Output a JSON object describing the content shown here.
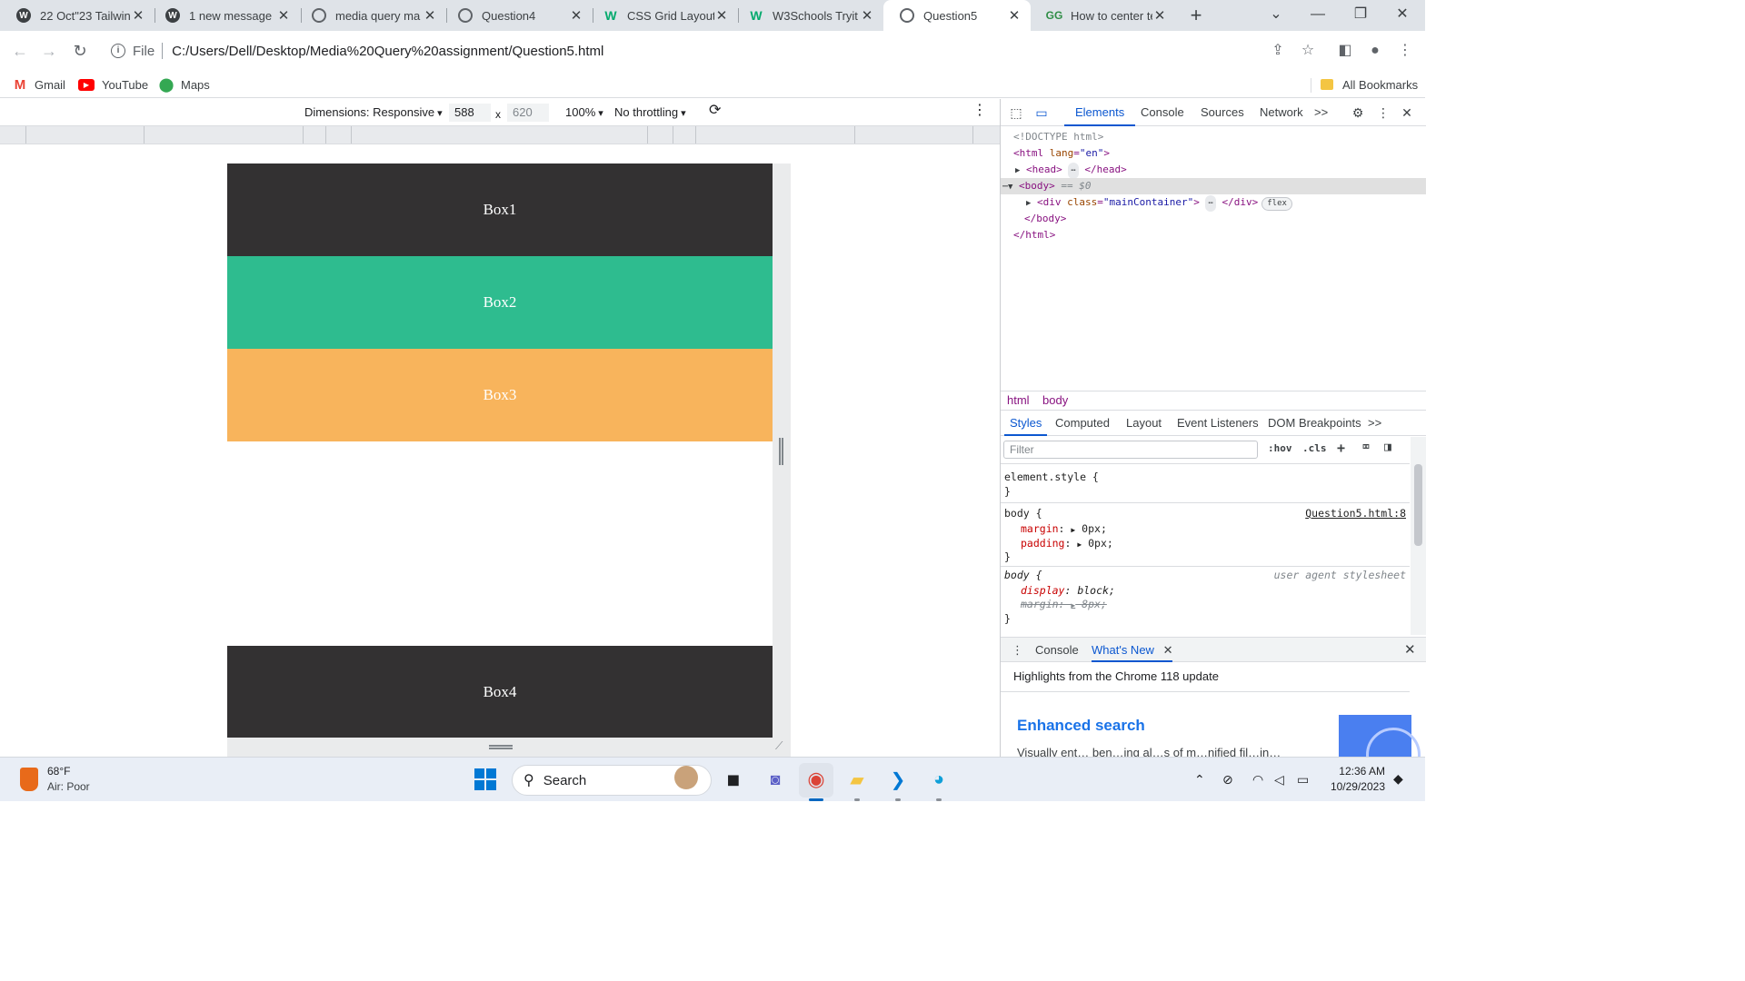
{
  "browser": {
    "tabs": [
      {
        "title": "22 Oct\"23 Tailwin",
        "favicon": "wordpress-icon",
        "active": false
      },
      {
        "title": "1 new message",
        "favicon": "wordpress-icon",
        "active": false
      },
      {
        "title": "media query ma",
        "favicon": "globe-icon",
        "active": false
      },
      {
        "title": "Question4",
        "favicon": "globe-icon",
        "active": false
      },
      {
        "title": "CSS Grid Layout",
        "favicon": "w3schools-icon",
        "active": false
      },
      {
        "title": "W3Schools Tryit",
        "favicon": "w3schools-icon",
        "active": false
      },
      {
        "title": "Question5",
        "favicon": "globe-icon",
        "active": true
      },
      {
        "title": "How to center te",
        "favicon": "geeksforgeeks-icon",
        "active": false
      }
    ],
    "new_tab": "+",
    "window_controls": {
      "tab_search": "⌄",
      "minimize": "—",
      "maximize": "❐",
      "close": "✕"
    },
    "address": {
      "scheme_label": "File",
      "url": "C:/Users/Dell/Desktop/Media%20Query%20assignment/Question5.html"
    },
    "bookmarks": [
      {
        "label": "Gmail"
      },
      {
        "label": "YouTube"
      },
      {
        "label": "Maps"
      }
    ],
    "all_bookmarks": "All Bookmarks"
  },
  "device_toolbar": {
    "dimensions": "Dimensions: Responsive",
    "width": "588",
    "times": "x",
    "height": "620",
    "zoom": "100%",
    "throttling": "No throttling"
  },
  "page": {
    "boxes": [
      {
        "label": "Box1",
        "color": "#333132"
      },
      {
        "label": "Box2",
        "color": "#2ebc8f"
      },
      {
        "label": "Box3",
        "color": "#f8b45c"
      },
      {
        "label": "Box4",
        "color": "#333132"
      }
    ]
  },
  "devtools": {
    "tabs": [
      "Elements",
      "Console",
      "Sources",
      "Network"
    ],
    "more_tabs": ">>",
    "elements": {
      "doctype": "<!DOCTYPE html>",
      "html_open_tag": "html",
      "html_attr_name": "lang",
      "html_attr_value": "\"en\"",
      "head_tag": "head",
      "body_tag": "body",
      "body_marker": "== $0",
      "div_tag": "div",
      "div_attr_name": "class",
      "div_attr_value": "\"mainContainer\"",
      "ellipsis": "⋯",
      "flex_badge": "flex"
    },
    "breadcrumbs": [
      "html",
      "body"
    ],
    "styles_tabs": [
      "Styles",
      "Computed",
      "Layout",
      "Event Listeners",
      "DOM Breakpoints"
    ],
    "filter_placeholder": "Filter",
    "filter_tools": {
      "hov": ":hov",
      "cls": ".cls"
    },
    "rules": {
      "element_style": "element.style {",
      "body_rule_selector": "body {",
      "body_rule_source": "Question5.html:8",
      "body_rule_props": [
        {
          "name": "margin",
          "value": "0px;"
        },
        {
          "name": "padding",
          "value": "0px;"
        }
      ],
      "ua_rule_selector": "body {",
      "ua_rule_source": "user agent stylesheet",
      "ua_rule_props": [
        {
          "name": "display",
          "value": "block;"
        },
        {
          "name": "margin",
          "value": "8px;"
        }
      ],
      "close_brace": "}"
    },
    "drawer": {
      "tabs": [
        "Console",
        "What's New"
      ],
      "highlights": "Highlights from the Chrome 118 update",
      "heading": "Enhanced search",
      "text": "Visually ent… ben…ing al…s of m…nified fil…in…"
    }
  },
  "taskbar": {
    "weather_temp": "68°F",
    "weather_condition": "Air: Poor",
    "search_label": "Search",
    "time": "12:36 AM",
    "date": "10/29/2023"
  }
}
